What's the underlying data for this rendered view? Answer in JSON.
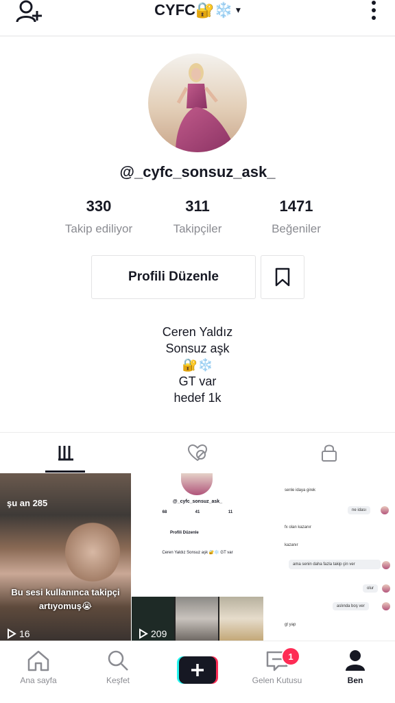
{
  "header": {
    "title": "CYFC🔐❄️",
    "caret": "▾"
  },
  "profile": {
    "username": "@_cyfc_sonsuz_ask_",
    "stats": [
      {
        "num": "330",
        "label": "Takip ediliyor"
      },
      {
        "num": "311",
        "label": "Takipçiler"
      },
      {
        "num": "1471",
        "label": "Beğeniler"
      }
    ],
    "edit_label": "Profili Düzenle",
    "bio": [
      "Ceren Yaldız",
      "Sonsuz aşk",
      "🔐❄️",
      "GT var",
      "hedef 1k"
    ]
  },
  "videos": [
    {
      "text_top": "şu an 285",
      "text_bottom": "Bu sesi kullanınca takipçi artıyomuş😭",
      "views": "16"
    },
    {
      "views": "209",
      "mini": {
        "username": "@_cyfc_sonsuz_ask_",
        "stats": [
          "68",
          "41",
          "11"
        ],
        "button": "Profili Düzenle",
        "bio": "Ceren Yaldız Sonsuz aşk 🔐❄️ GT var"
      }
    },
    {
      "chat": [
        "senle idaya girek",
        "ne idası",
        "fx olan kazanır",
        "kazanır",
        "ama senin daha fazla takip çin ver",
        "olur",
        "aslında boş ver",
        "gt yap"
      ]
    }
  ],
  "bottom_nav": [
    {
      "label": "Ana sayfa"
    },
    {
      "label": "Keşfet"
    },
    {
      "label": "Gelen Kutusu",
      "badge": "1"
    },
    {
      "label": "Ben"
    }
  ]
}
